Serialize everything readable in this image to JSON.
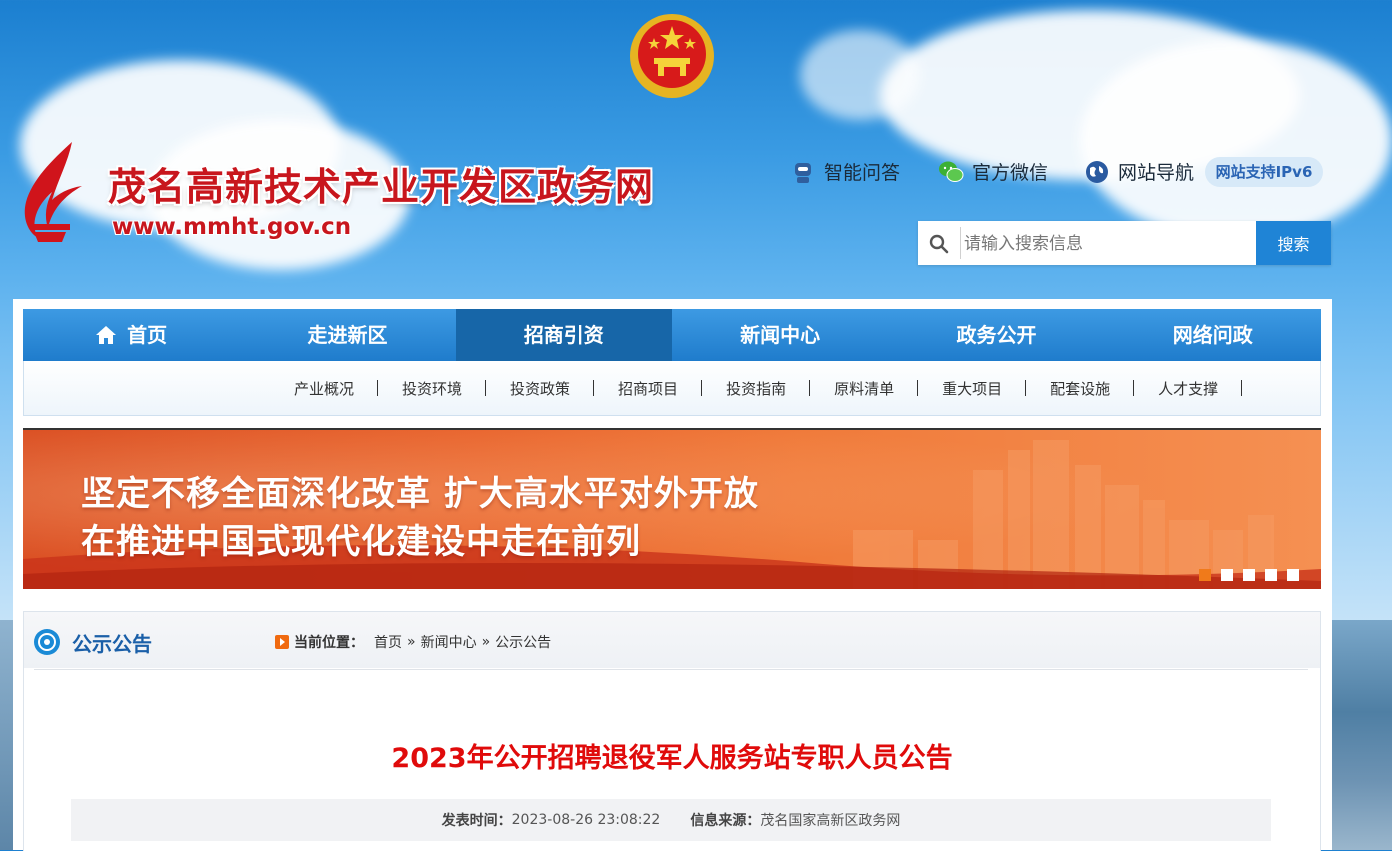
{
  "header": {
    "site_title": "茂名高新技术产业开发区政务网",
    "site_url": "www.mmht.gov.cn",
    "tools": {
      "qa": "智能问答",
      "wechat": "官方微信",
      "sitemap": "网站导航",
      "ipv6": "网站支持IPv6"
    },
    "search": {
      "placeholder": "请输入搜索信息",
      "button": "搜索"
    }
  },
  "nav": {
    "items": [
      {
        "label": "首页"
      },
      {
        "label": "走进新区"
      },
      {
        "label": "招商引资",
        "active": true
      },
      {
        "label": "新闻中心"
      },
      {
        "label": "政务公开"
      },
      {
        "label": "网络问政"
      }
    ],
    "sub_items": [
      "产业概况",
      "投资环境",
      "投资政策",
      "招商项目",
      "投资指南",
      "原料清单",
      "重大项目",
      "配套设施",
      "人才支撑"
    ]
  },
  "banner": {
    "line1": "坚定不移全面深化改革 扩大高水平对外开放",
    "line2": "在推进中国式现代化建设中走在前列",
    "slide_count": 5,
    "active_slide": 1
  },
  "section": {
    "title": "公示公告",
    "breadcrumb_label": "当前位置：",
    "breadcrumb": [
      "首页",
      "新闻中心",
      "公示公告"
    ],
    "breadcrumb_sep": "»"
  },
  "article": {
    "title": "2023年公开招聘退役军人服务站专职人员公告",
    "publish_label": "发表时间：",
    "publish_time": "2023-08-26 23:08:22",
    "source_label": "信息来源：",
    "source": "茂名国家高新区政务网"
  },
  "colors": {
    "brand_red": "#c8161d",
    "nav_blue": "#1f7ccc",
    "nav_active": "#1766a8",
    "title_red": "#e00b0b",
    "dot_active": "#f07a1a"
  }
}
